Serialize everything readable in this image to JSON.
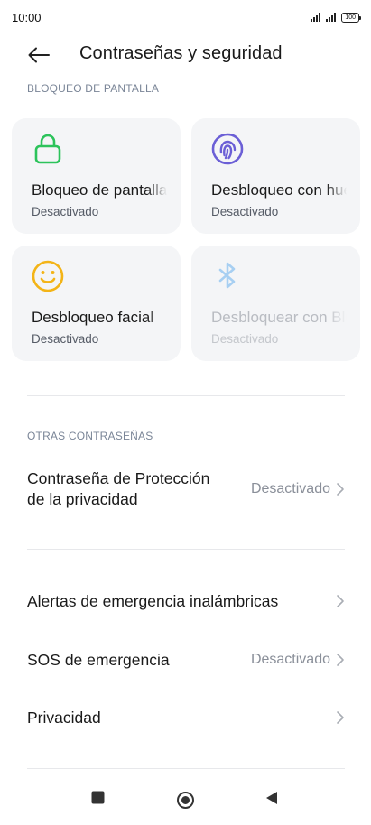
{
  "status_bar": {
    "time": "10:00",
    "battery": "100"
  },
  "header": {
    "title": "Contraseñas y seguridad"
  },
  "screen_lock": {
    "section_label": "BLOQUEO DE PANTALLA",
    "cards": [
      {
        "title": "Bloqueo de pantalla",
        "subtitle": "Desactivado",
        "icon": "lock-icon",
        "color": "#2cc35b"
      },
      {
        "title": "Desbloqueo con huella",
        "subtitle": "Desactivado",
        "icon": "fingerprint-icon",
        "color": "#6b5fd6"
      },
      {
        "title": "Desbloqueo facial",
        "subtitle": "Desactivado",
        "icon": "face-icon",
        "color": "#f3b417"
      },
      {
        "title": "Desbloquear con Bluetooth",
        "subtitle": "Desactivado",
        "icon": "bluetooth-icon",
        "color": "#a7cff2"
      }
    ]
  },
  "other_passwords": {
    "section_label": "OTRAS CONTRASEÑAS",
    "privacy_password": {
      "title_line1": "Contraseña de Protección",
      "title_line2": "de la privacidad",
      "value": "Desactivado"
    }
  },
  "list": {
    "emergency_alerts": {
      "title": "Alertas de emergencia inalámbricas"
    },
    "emergency_sos": {
      "title": "SOS de emergencia",
      "value": "Desactivado"
    },
    "privacy": {
      "title": "Privacidad"
    }
  },
  "colors": {
    "accent": "#6b5fd6",
    "card_bg": "#f4f5f7",
    "secondary_text": "#8a8f99"
  }
}
